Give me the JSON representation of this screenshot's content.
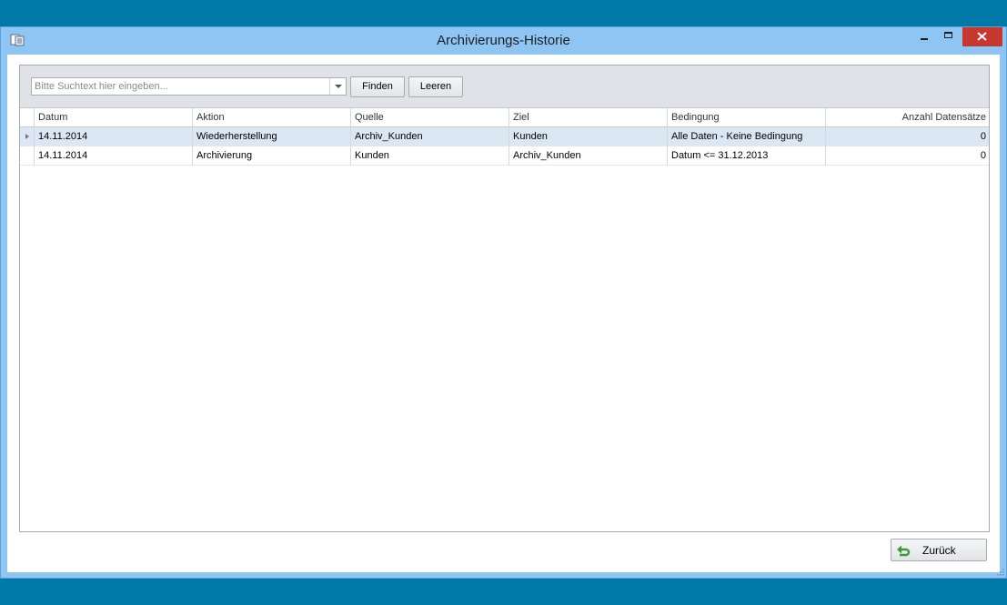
{
  "window": {
    "title": "Archivierungs-Historie",
    "colors": {
      "desktop": "#0078a8",
      "frame": "#8ec5f2",
      "close": "#c7372f",
      "selected_row": "#dce7f4"
    },
    "icons": [
      "app-icon",
      "minimize-icon",
      "maximize-icon",
      "close-icon"
    ]
  },
  "search": {
    "placeholder": "Bitte Suchtext hier eingeben...",
    "value": "",
    "find_label": "Finden",
    "clear_label": "Leeren"
  },
  "grid": {
    "columns": [
      "Datum",
      "Aktion",
      "Quelle",
      "Ziel",
      "Bedingung",
      "Anzahl Datensätze"
    ],
    "rows": [
      {
        "datum": "14.11.2014",
        "aktion": "Wiederherstellung",
        "quelle": "Archiv_Kunden",
        "ziel": "Kunden",
        "bedingung": "Alle Daten - Keine Bedingung",
        "anzahl": "0",
        "selected": true
      },
      {
        "datum": "14.11.2014",
        "aktion": "Archivierung",
        "quelle": "Kunden",
        "ziel": "Archiv_Kunden",
        "bedingung": "Datum <= 31.12.2013",
        "anzahl": "0",
        "selected": false
      }
    ]
  },
  "footer": {
    "back_label": "Zurück",
    "back_icon": "undo-arrow-icon"
  }
}
